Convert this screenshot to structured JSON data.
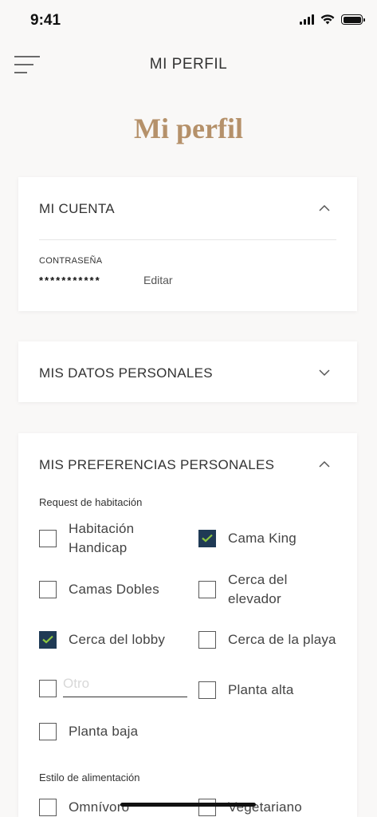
{
  "status_bar": {
    "time": "9:41"
  },
  "nav": {
    "title": "MI PERFIL"
  },
  "page": {
    "title": "Mi perfil"
  },
  "account": {
    "title": "MI CUENTA",
    "password_label": "CONTRASEÑA",
    "password_value": "***********",
    "edit_label": "Editar"
  },
  "personal_data": {
    "title": "MIS DATOS PERSONALES"
  },
  "preferences": {
    "title": "MIS PREFERENCIAS PERSONALES",
    "room_request_label": "Request de habitación",
    "room_options": [
      {
        "label": "Habitación Handicap",
        "checked": false
      },
      {
        "label": "Cama King",
        "checked": true
      },
      {
        "label": "Camas Dobles",
        "checked": false
      },
      {
        "label": "Cerca del elevador",
        "checked": false
      },
      {
        "label": "Cerca del lobby",
        "checked": true
      },
      {
        "label": "Cerca de la playa",
        "checked": false
      },
      {
        "label": "Planta alta",
        "checked": false
      },
      {
        "label": "Planta baja",
        "checked": false
      }
    ],
    "other_placeholder": "Otro",
    "diet_label": "Estilo de alimentación",
    "diet_options": [
      {
        "label": "Omnívoro",
        "checked": false
      },
      {
        "label": "Vegetariano",
        "checked": false
      }
    ]
  },
  "colors": {
    "accent_gold": "#b5916a",
    "checkbox_checked": "#1f3a55",
    "check_mark": "#8cc63f"
  }
}
